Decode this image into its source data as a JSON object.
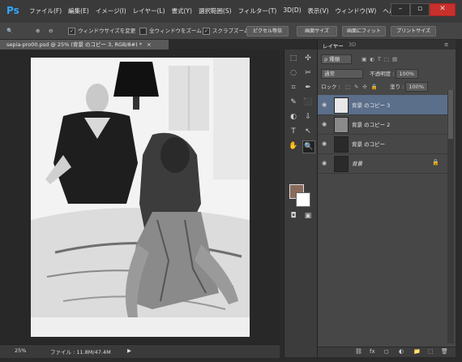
{
  "app": {
    "logo": "Ps"
  },
  "menu": [
    "ファイル(F)",
    "編集(E)",
    "イメージ(I)",
    "レイヤー(L)",
    "書式(Y)",
    "選択範囲(S)",
    "フィルター(T)",
    "3D(D)",
    "表示(V)",
    "ウィンドウ(W)",
    "ヘルプ"
  ],
  "window_controls": {
    "minimize": "–",
    "maximize": "▫",
    "close": "✕"
  },
  "options": {
    "zoom_tool": "🔍",
    "resize_window": "ウィンドウサイズを変更",
    "zoom_all": "全ウィンドウをズーム",
    "scrubby": "スクラブズーム",
    "btn_pixel": "ピクセル等倍",
    "btn_screen": "画面サイズ",
    "btn_fit": "画面にフィット",
    "btn_print": "プリントサイズ"
  },
  "document": {
    "tab": "sepia-pro00.psd @ 25% (背景 のコピー 3, RGB/8#) *",
    "close": "×"
  },
  "status": {
    "zoom": "25%",
    "file": "ファイル : 11.8M/47.4M"
  },
  "tools": [
    "⬚",
    "✣",
    "◌",
    "✂",
    "⌗",
    "✒",
    "✎",
    "⬛",
    "◐",
    "⇩",
    "T",
    "↖",
    "✋",
    "🔍"
  ],
  "colors": {
    "foreground": "#8a6a5a",
    "background": "#ffffff",
    "selected_layer": "#5b6e8a",
    "canvas": "#f2f2f2"
  },
  "layers_panel": {
    "tab_layers": "レイヤー",
    "tab_3d": "3D",
    "kind_label": "ρ 種類",
    "blend_mode": "通常",
    "opacity_label": "不透明度 :",
    "opacity": "100%",
    "lock_label": "ロック :",
    "fill_label": "塗り :",
    "fill": "100%",
    "layers": [
      {
        "name": "背景 のコピー 3",
        "selected": true
      },
      {
        "name": "背景 のコピー 2",
        "selected": false
      },
      {
        "name": "背景 のコピー",
        "selected": false
      },
      {
        "name": "背景",
        "selected": false,
        "locked": true
      }
    ],
    "footer": [
      "⛓",
      "fx",
      "◻",
      "◐",
      "📁",
      "⬚",
      "🗑"
    ]
  }
}
